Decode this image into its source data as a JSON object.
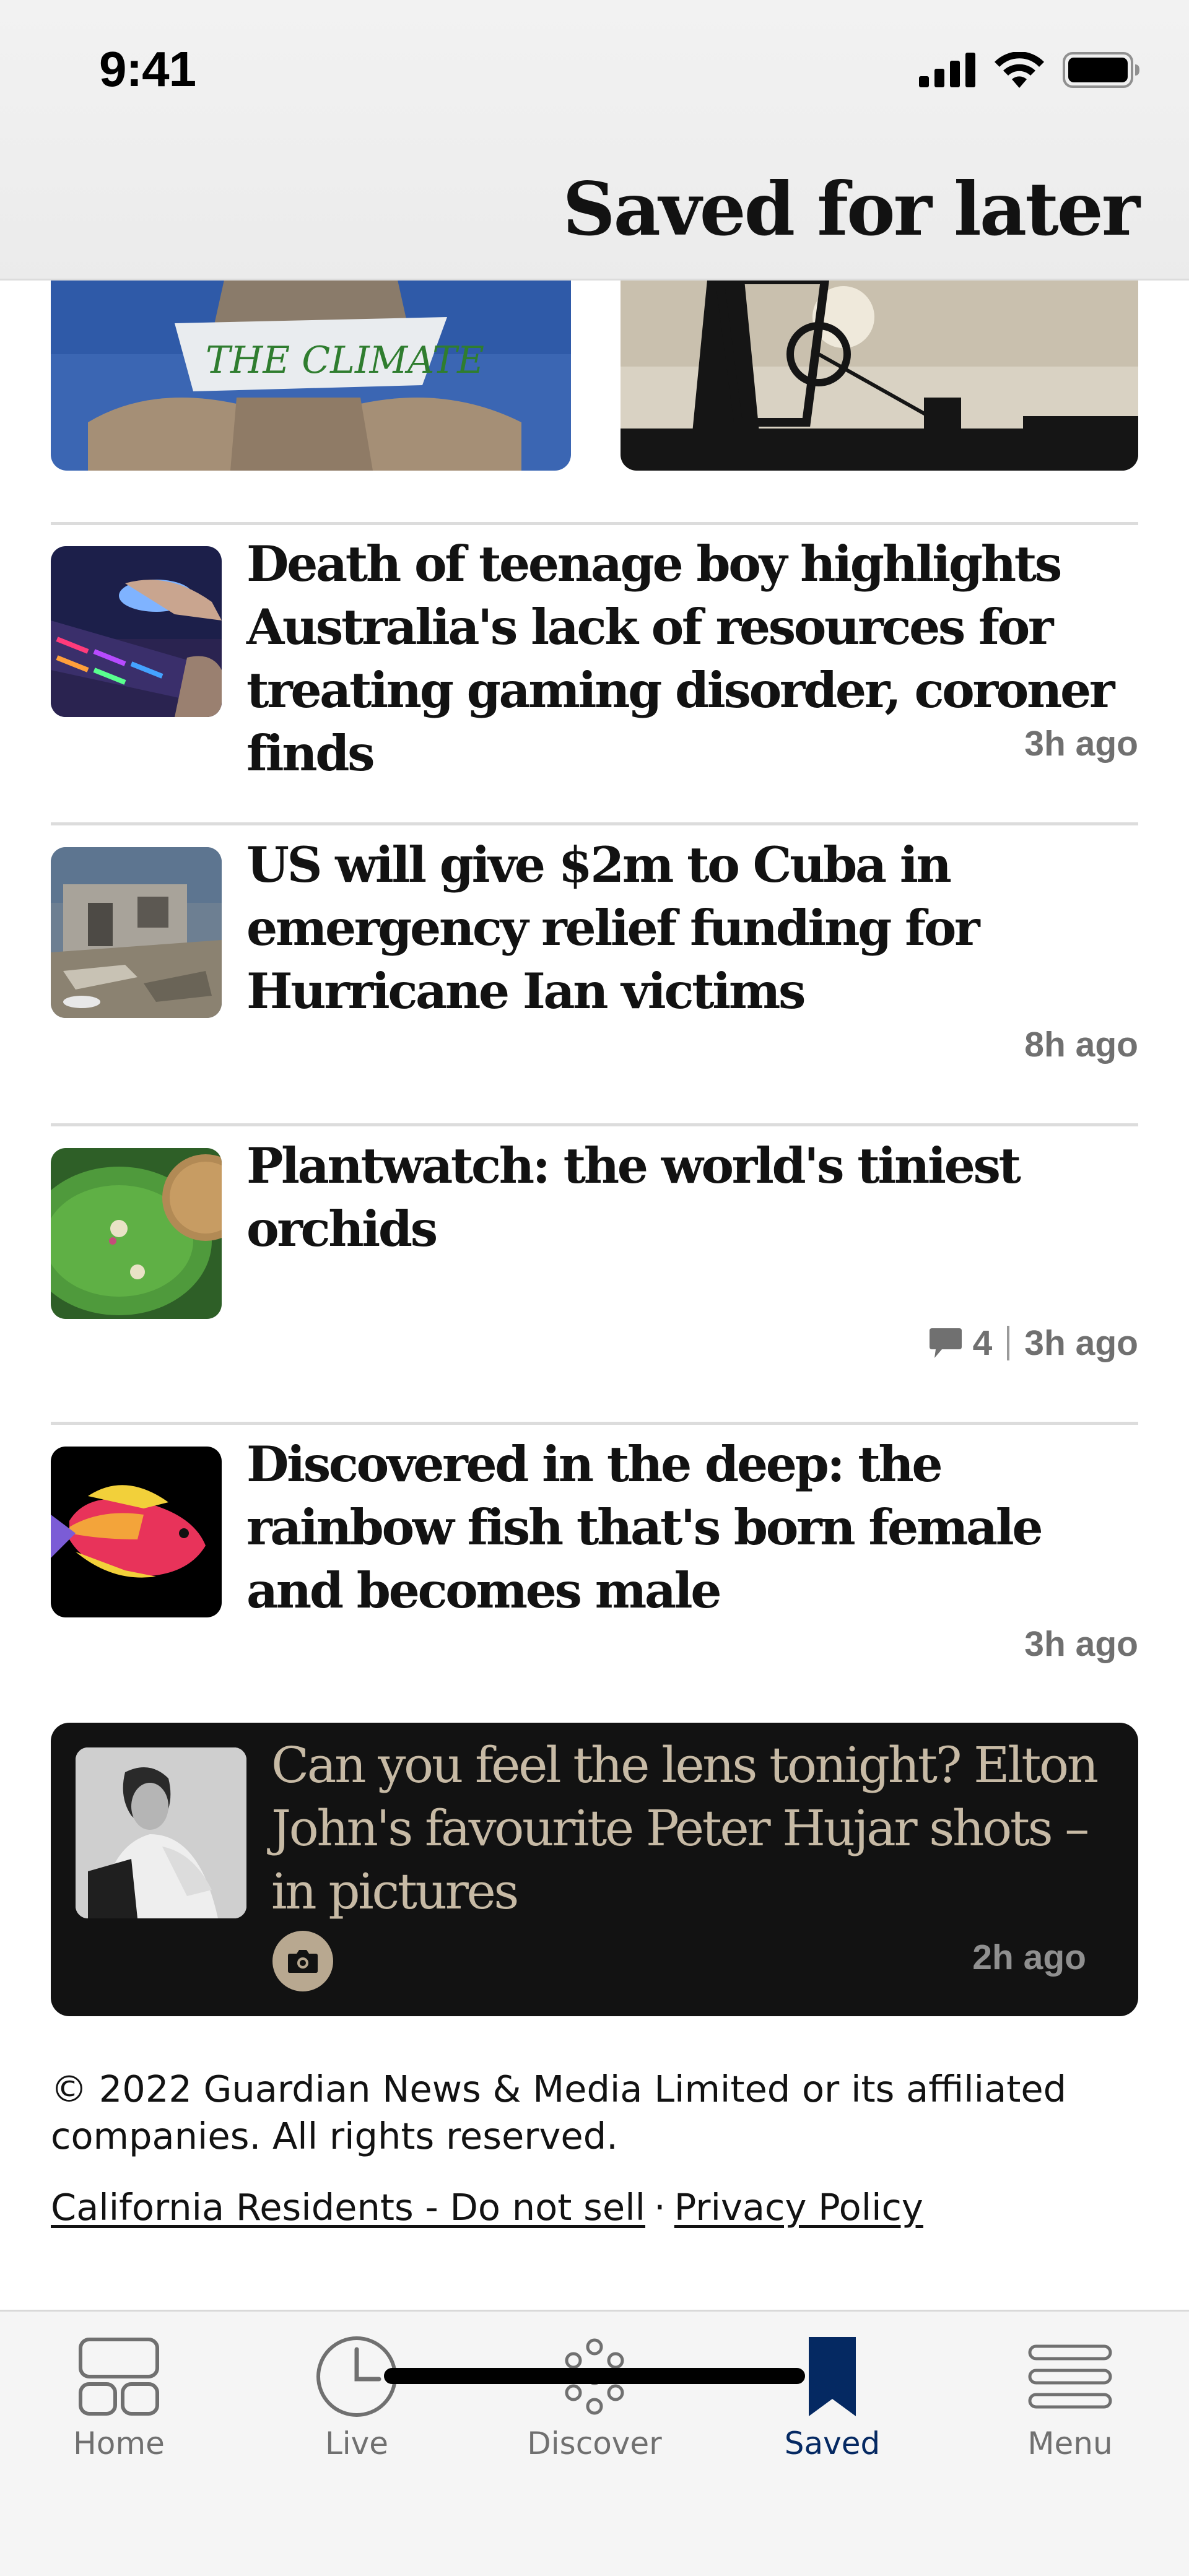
{
  "status_bar": {
    "time": "9:41"
  },
  "header": {
    "title": "Saved for later"
  },
  "articles": [
    {
      "headline": "Death of teenage boy highlights Australia's lack of resources for treating gaming disorder, coroner finds",
      "time": "3h ago"
    },
    {
      "headline": "US will give $2m to Cuba in emergency relief funding for Hurricane Ian victims",
      "time": "8h ago"
    },
    {
      "headline": "Plantwatch: the world's tiniest orchids",
      "comments": "4",
      "time": "3h ago"
    },
    {
      "headline": "Discovered in the deep: the rainbow fish that's born female and becomes male",
      "time": "3h ago"
    }
  ],
  "gallery_card": {
    "headline": "Can you feel the lens tonight? Elton John's favourite Peter Hujar shots – in pictures",
    "time": "2h ago",
    "icon": "camera-icon"
  },
  "footer": {
    "copyright": "© 2022 Guardian News & Media Limited or its affiliated companies. All rights reserved.",
    "links": [
      "California Residents - Do not sell",
      "Privacy Policy"
    ],
    "separator": "·"
  },
  "tabbar": {
    "tabs": [
      {
        "label": "Home",
        "icon": "home-icon"
      },
      {
        "label": "Live",
        "icon": "clock-icon"
      },
      {
        "label": "Discover",
        "icon": "discover-icon"
      },
      {
        "label": "Saved",
        "icon": "bookmark-icon"
      },
      {
        "label": "Menu",
        "icon": "menu-icon"
      }
    ],
    "active": "Saved"
  },
  "colors": {
    "brand_blue": "#052962",
    "dark_card": "#121212",
    "card_text": "#c7baa5",
    "meta_grey": "#707070"
  }
}
